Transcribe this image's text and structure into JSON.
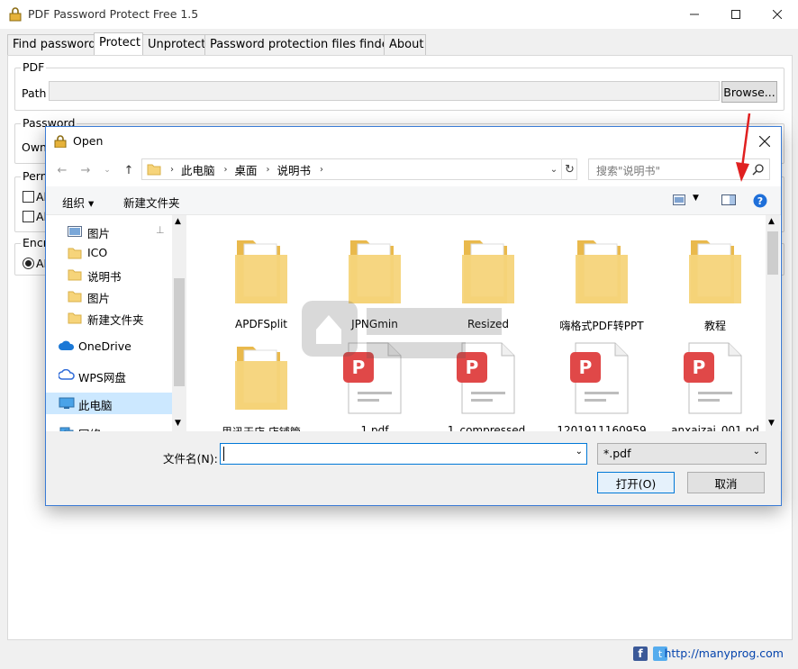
{
  "app": {
    "title": "PDF Password Protect Free 1.5",
    "tabs": [
      "Find password",
      "Protect",
      "Unprotect",
      "Password protection files finder",
      "About"
    ],
    "active_tab": "Protect",
    "pdf_group": {
      "label": "PDF",
      "path_label": "Path",
      "path_value": "",
      "browse_label": "Browse..."
    },
    "password_group": {
      "label": "Password",
      "owner_label_partial": "Own"
    },
    "perm_group": {
      "label_partial": "Perm",
      "items_partial": [
        "Al",
        "Al"
      ]
    },
    "encrypt_group": {
      "label_partial": "Encr",
      "radio_partial": "AE"
    },
    "footer_link": "http://manyprog.com",
    "footer_icons": [
      "facebook-icon",
      "twitter-icon"
    ]
  },
  "dialog": {
    "title": "Open",
    "breadcrumb": [
      "此电脑",
      "桌面",
      "说明书"
    ],
    "search_placeholder": "搜索\"说明书\"",
    "toolbar": {
      "organize": "组织 ▾",
      "new_folder": "新建文件夹"
    },
    "nav_items": [
      {
        "label": "图片",
        "icon": "pictures-icon",
        "pinned": true
      },
      {
        "label": "ICO",
        "icon": "folder-icon"
      },
      {
        "label": "说明书",
        "icon": "folder-icon"
      },
      {
        "label": "图片",
        "icon": "folder-icon"
      },
      {
        "label": "新建文件夹",
        "icon": "folder-icon"
      },
      {
        "label": "OneDrive",
        "icon": "cloud-icon"
      },
      {
        "label": "WPS网盘",
        "icon": "wps-cloud-icon"
      },
      {
        "label": "此电脑",
        "icon": "computer-icon",
        "selected": true
      },
      {
        "label": "网络",
        "icon": "network-icon"
      }
    ],
    "files": [
      {
        "name": "APDFSplit",
        "type": "folder"
      },
      {
        "name": "JPNGmin",
        "type": "folder"
      },
      {
        "name": "Resized",
        "type": "folder"
      },
      {
        "name": "嗨格式PDF转PPT",
        "type": "folder"
      },
      {
        "name": "教程",
        "type": "folder"
      },
      {
        "name": "思迅天店 店铺管",
        "type": "folder"
      },
      {
        "name": "1.pdf",
        "type": "pdf"
      },
      {
        "name": "1_compressed.",
        "type": "pdf"
      },
      {
        "name": "1201911160959",
        "type": "pdf"
      },
      {
        "name": "anxaizai_001.pd",
        "type": "pdf"
      }
    ],
    "filename_label": "文件名(N):",
    "filename_value": "",
    "file_type": "*.pdf",
    "open_label": "打开(O)",
    "cancel_label": "取消"
  },
  "colors": {
    "accent": "#0078d7",
    "pdf_red": "#e04848",
    "folder": "#f6d47a",
    "annotation_arrow": "#e02020"
  }
}
